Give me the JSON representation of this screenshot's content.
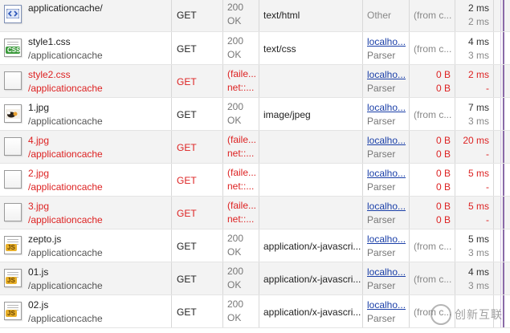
{
  "rows": [
    {
      "name": "applicationcache/",
      "path": "",
      "method": "GET",
      "status": "200",
      "status_text": "OK",
      "type": "text/html",
      "initiator": "Other",
      "initiator2": "",
      "size": "(from c...",
      "size2": "",
      "time": "2 ms",
      "latency": "2 ms",
      "icon": "html-document-icon",
      "error": false
    },
    {
      "name": "style1.css",
      "path": "/applicationcache",
      "method": "GET",
      "status": "200",
      "status_text": "OK",
      "type": "text/css",
      "initiator": "localho...",
      "initiator2": "Parser",
      "size": "(from c...",
      "size2": "",
      "time": "4 ms",
      "latency": "3 ms",
      "icon": "css-file-icon",
      "error": false
    },
    {
      "name": "style2.css",
      "path": "/applicationcache",
      "method": "GET",
      "status": "(faile...",
      "status_text": "net::...",
      "type": "",
      "initiator": "localho...",
      "initiator2": "Parser",
      "size": "0 B",
      "size2": "0 B",
      "time": "2 ms",
      "latency": "-",
      "icon": "blank-file-icon",
      "error": true
    },
    {
      "name": "1.jpg",
      "path": "/applicationcache",
      "method": "GET",
      "status": "200",
      "status_text": "OK",
      "type": "image/jpeg",
      "initiator": "localho...",
      "initiator2": "Parser",
      "size": "(from c...",
      "size2": "",
      "time": "7 ms",
      "latency": "3 ms",
      "icon": "image-thumbnail-icon",
      "error": false
    },
    {
      "name": "4.jpg",
      "path": "/applicationcache",
      "method": "GET",
      "status": "(faile...",
      "status_text": "net::...",
      "type": "",
      "initiator": "localho...",
      "initiator2": "Parser",
      "size": "0 B",
      "size2": "0 B",
      "time": "20 ms",
      "latency": "-",
      "icon": "blank-file-icon",
      "error": true
    },
    {
      "name": "2.jpg",
      "path": "/applicationcache",
      "method": "GET",
      "status": "(faile...",
      "status_text": "net::...",
      "type": "",
      "initiator": "localho...",
      "initiator2": "Parser",
      "size": "0 B",
      "size2": "0 B",
      "time": "5 ms",
      "latency": "-",
      "icon": "blank-file-icon",
      "error": true
    },
    {
      "name": "3.jpg",
      "path": "/applicationcache",
      "method": "GET",
      "status": "(faile...",
      "status_text": "net::...",
      "type": "",
      "initiator": "localho...",
      "initiator2": "Parser",
      "size": "0 B",
      "size2": "0 B",
      "time": "5 ms",
      "latency": "-",
      "icon": "blank-file-icon",
      "error": true
    },
    {
      "name": "zepto.js",
      "path": "/applicationcache",
      "method": "GET",
      "status": "200",
      "status_text": "OK",
      "type": "application/x-javascri...",
      "initiator": "localho...",
      "initiator2": "Parser",
      "size": "(from c...",
      "size2": "",
      "time": "5 ms",
      "latency": "3 ms",
      "icon": "js-file-icon",
      "error": false
    },
    {
      "name": "01.js",
      "path": "/applicationcache",
      "method": "GET",
      "status": "200",
      "status_text": "OK",
      "type": "application/x-javascri...",
      "initiator": "localho...",
      "initiator2": "Parser",
      "size": "(from c...",
      "size2": "",
      "time": "4 ms",
      "latency": "3 ms",
      "icon": "js-file-icon",
      "error": false
    },
    {
      "name": "02.js",
      "path": "/applicationcache",
      "method": "GET",
      "status": "200",
      "status_text": "OK",
      "type": "application/x-javascri...",
      "initiator": "localho...",
      "initiator2": "Parser",
      "size": "(from c...",
      "size2": "",
      "time": "",
      "latency": "",
      "icon": "js-file-icon",
      "error": false
    }
  ],
  "watermark": {
    "text": "创新互联"
  },
  "colors": {
    "error": "#dd2222",
    "link": "#1a3fa8",
    "timeline": "#8a6aa8",
    "alt_row": "#f3f3f3"
  }
}
